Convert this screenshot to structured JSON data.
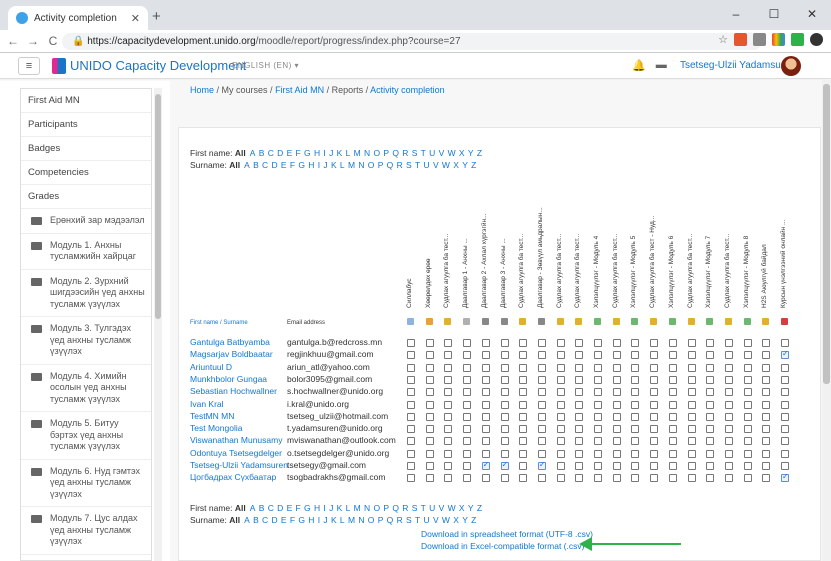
{
  "browser": {
    "tab_title": "Activity completion",
    "url_host": "https://capacitydevelopment.unido.org",
    "url_path": "/moodle/report/progress/index.php?course=27"
  },
  "navbar": {
    "brand": "UNIDO Capacity Development",
    "language": "ENGLISH (EN) ▾",
    "user": "Tsetseg-Ulzii Yadamsuren"
  },
  "breadcrumb": {
    "home": "Home",
    "my_courses": "My courses",
    "course": "First Aid MN",
    "reports": "Reports",
    "current": "Activity completion"
  },
  "sidebar": {
    "items": [
      "First Aid MN",
      "Participants",
      "Badges",
      "Competencies",
      "Grades"
    ],
    "sections": [
      "Ерөнхий зар мэдээлэл",
      "Модуль 1. Анхны тусламжийн хайрцаг",
      "Модуль 2. Зурхний шигдээсийн үед анхны тусламж үзүүлэх",
      "Модуль 3. Тулгэдэх үед анхны тусламж үзүүлэх",
      "Модуль 4. Химийн осолын үед анхны тусламж үзүүлэх",
      "Модуль 5. Битуу бэртэх үед анхны тусламж үзүүлэх",
      "Модуль 6. Нуд гэмтэх үед анхны тусламж үзүүлэх",
      "Модуль 7. Цус алдах үед анхны тусламж үзүүлэх"
    ]
  },
  "filters": {
    "first_name_label": "First name:",
    "surname_label": "Surname:",
    "all": "All",
    "letters": [
      "A",
      "B",
      "C",
      "D",
      "E",
      "F",
      "G",
      "H",
      "I",
      "J",
      "K",
      "L",
      "M",
      "N",
      "O",
      "P",
      "Q",
      "R",
      "S",
      "T",
      "U",
      "V",
      "W",
      "X",
      "Y",
      "Z"
    ]
  },
  "table": {
    "col_firstname": "First name / Surname",
    "col_email": "Email address",
    "activities": [
      "Силлабус",
      "Хөөрөлдөх өрөө",
      "Судлах агуулга ба тест...",
      "Даалгавар 1 - Анхны ...",
      "Даалгавар 2 - Ахлал хүргэгйн...",
      "Даалгавар 3 - Анхны ...",
      "Судлах агуулга ба тест...",
      "Даалгавар - Зөвүүл амьдралын...",
      "Судлах агуулга ба тест...",
      "Судлах агуулга ба тест...",
      "Хэлэлцүүлэг - Модуль 4",
      "Судлах агуулга ба тест...",
      "Хэлэлцүүлэг - Модуль 5",
      "Судлах агуулга ба тест - Нуд...",
      "Хэлэлцүүлэг - Модуль 6",
      "Судлах агуулга ба тест...",
      "Хэлэлцүүлэг - Модуль 7",
      "Судлах агуулга ба тест...",
      "Хэлэлцүүлэг - Модуль 8",
      "H2S Аюулгүй байдал",
      "Курсын үнэлгээний онлайн ..."
    ],
    "rows": [
      {
        "name": "Gantulga Batbyamba",
        "email": "gantulga.b@redcross.mn",
        "done": []
      },
      {
        "name": "Magsarjav Boldbaatar",
        "email": "regjinkhuu@gmail.com",
        "done": [
          20
        ]
      },
      {
        "name": "Ariuntuul D",
        "email": "ariun_atl@yahoo.com",
        "done": []
      },
      {
        "name": "Munkhbolor Gungaa",
        "email": "bolor3095@gmail.com",
        "done": []
      },
      {
        "name": "Sebastian Hochwallner",
        "email": "s.hochwallner@unido.org",
        "done": []
      },
      {
        "name": "Ivan Kral",
        "email": "i.kral@unido.org",
        "done": []
      },
      {
        "name": "TestMN MN",
        "email": "tsetseg_ulzii@hotmail.com",
        "done": []
      },
      {
        "name": "Test Mongolia",
        "email": "t.yadamsuren@unido.org",
        "done": []
      },
      {
        "name": "Viswanathan Munusamy",
        "email": "mviswanathan@outlook.com",
        "done": []
      },
      {
        "name": "Odontuya Tsetsegdelger",
        "email": "o.tsetsegdelger@unido.org",
        "done": []
      },
      {
        "name": "Tsetseg-Ulzii Yadamsuren",
        "email": "tsetsegy@gmail.com",
        "done": [
          4,
          5,
          7
        ]
      },
      {
        "name": "Цогбадрах Сүхбаатар",
        "email": "tsogbadrakhs@gmail.com",
        "done": [
          20
        ]
      }
    ]
  },
  "downloads": {
    "csv_utf8": "Download in spreadsheet format (UTF-8 .csv)",
    "csv_excel": "Download in Excel-compatible format (.csv)"
  },
  "colors": {
    "accent": "#1177d1",
    "arrow": "#2db34a"
  }
}
